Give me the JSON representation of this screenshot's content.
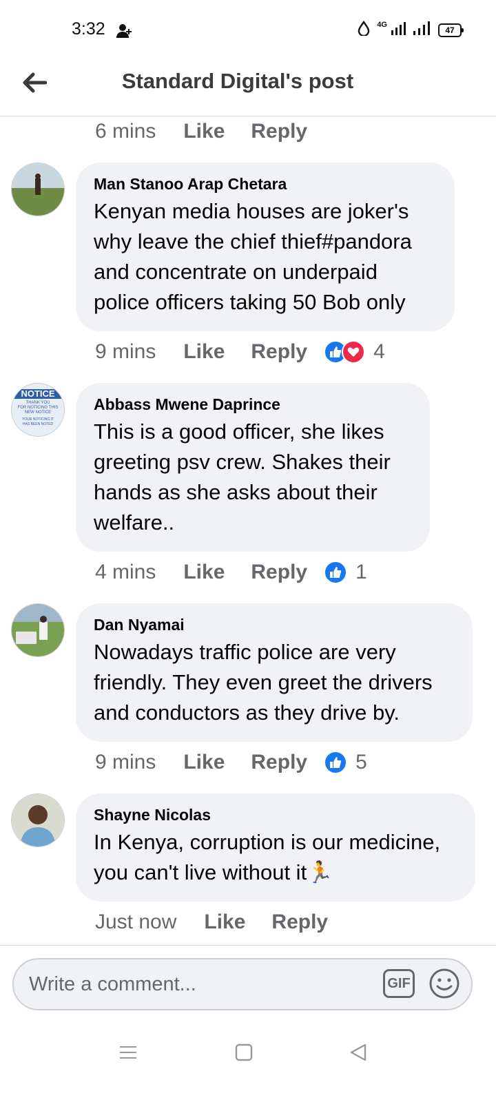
{
  "status_bar": {
    "time": "3:32",
    "network": "4G",
    "battery": "47"
  },
  "header": {
    "title": "Standard Digital's post"
  },
  "top_meta": {
    "time": "6 mins",
    "like": "Like",
    "reply": "Reply"
  },
  "comments": [
    {
      "author": "Man Stanoo Arap Chetara",
      "text": "Kenyan media houses are joker's why leave the chief thief#pandora and concentrate on underpaid police officers taking 50 Bob only",
      "time": "9 mins",
      "like": "Like",
      "reply": "Reply",
      "reaction_count": "4"
    },
    {
      "author": "Abbass Mwene Daprince",
      "avatar_text": {
        "title": "NOTICE",
        "line1": "THANK YOU",
        "line2": "FOR NOTICING THIS",
        "line3": "NEW NOTICE",
        "line4": "YOUR NOTICING IT",
        "line5": "HAS BEEN NOTED"
      },
      "text": "This is a good officer, she likes greeting psv crew. Shakes their hands as she asks about their welfare..",
      "time": "4 mins",
      "like": "Like",
      "reply": "Reply",
      "reaction_count": "1"
    },
    {
      "author": "Dan Nyamai",
      "text": "Nowadays traffic police are very friendly. They even greet the drivers and conductors as they drive by.",
      "time": "9 mins",
      "like": "Like",
      "reply": "Reply",
      "reaction_count": "5"
    },
    {
      "author": "Shayne Nicolas",
      "text": "In Kenya, corruption is our medicine, you can't live without it",
      "emoji": "🏃",
      "time": "Just now",
      "like": "Like",
      "reply": "Reply"
    }
  ],
  "composer": {
    "placeholder": "Write a comment...",
    "gif": "GIF"
  },
  "icons": {
    "back": "arrow-left-icon",
    "add_person": "person-add-icon",
    "data_saver": "drop-icon",
    "like": "thumbs-up-icon",
    "love": "heart-icon",
    "emoji": "smiley-icon",
    "menu": "menu-icon",
    "home": "square-icon",
    "back_nav": "triangle-back-icon"
  },
  "colors": {
    "accent": "#1877f2",
    "love": "#f0284a",
    "bubble": "#f0f2f5",
    "meta": "#65676b"
  }
}
